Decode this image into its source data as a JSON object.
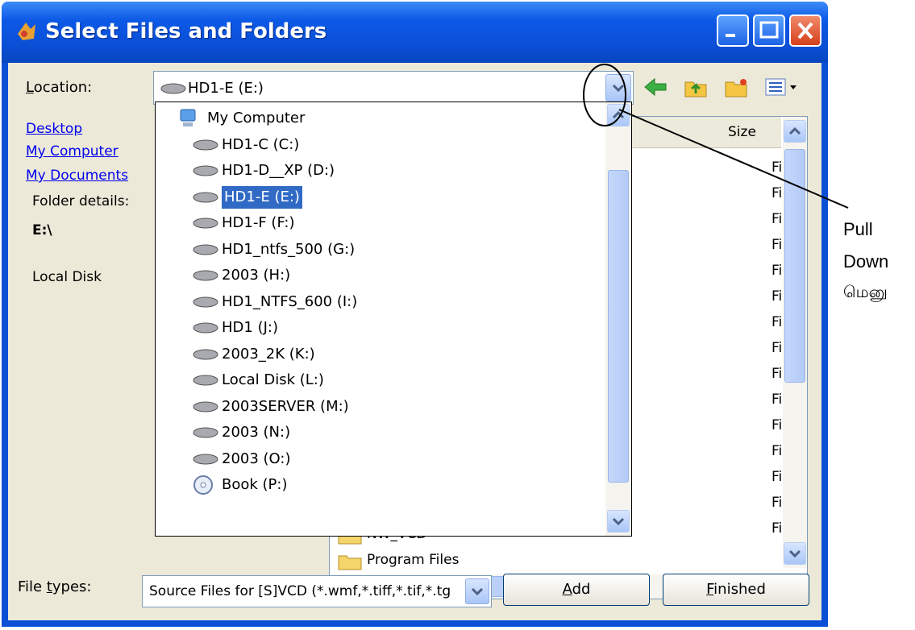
{
  "window": {
    "title": "Select Files and Folders"
  },
  "location": {
    "label": "Location:",
    "value": "HD1-E (E:)"
  },
  "left_pane": {
    "links": [
      "Desktop",
      "My Computer",
      "My Documents"
    ],
    "folder_details_label": "Folder details:",
    "path": "E:\\",
    "disk_type": "Local Disk"
  },
  "file_list": {
    "column_size": "Size",
    "type_cells": [
      "Fil",
      "Fil",
      "Fil",
      "Fil",
      "Fil",
      "Fil",
      "Fil",
      "Fil",
      "Fil",
      "Fil",
      "Fil",
      "Fil",
      "Fil",
      "Fil",
      "Fil"
    ],
    "visible_items": [
      "NW_VCD",
      "Program Files"
    ]
  },
  "dropdown": {
    "items": [
      {
        "label": "My Computer",
        "icon": "computer-icon"
      },
      {
        "label": "HD1-C (C:)",
        "icon": "drive-icon"
      },
      {
        "label": "HD1-D__XP (D:)",
        "icon": "drive-icon"
      },
      {
        "label": "HD1-E (E:)",
        "icon": "drive-icon",
        "selected": true
      },
      {
        "label": "HD1-F (F:)",
        "icon": "drive-icon"
      },
      {
        "label": "HD1_ntfs_500 (G:)",
        "icon": "drive-icon"
      },
      {
        "label": "2003 (H:)",
        "icon": "drive-icon"
      },
      {
        "label": "HD1_NTFS_600 (I:)",
        "icon": "drive-icon"
      },
      {
        "label": "HD1 (J:)",
        "icon": "drive-icon"
      },
      {
        "label": "2003_2K (K:)",
        "icon": "drive-icon"
      },
      {
        "label": "Local Disk (L:)",
        "icon": "drive-icon"
      },
      {
        "label": "2003SERVER (M:)",
        "icon": "drive-icon"
      },
      {
        "label": "2003 (N:)",
        "icon": "drive-icon"
      },
      {
        "label": "2003 (O:)",
        "icon": "drive-icon"
      },
      {
        "label": "Book (P:)",
        "icon": "cd-icon"
      }
    ]
  },
  "file_types": {
    "label": "File types:",
    "value": "Source Files for [S]VCD  (*.wmf,*.tiff,*.tif,*.tg"
  },
  "buttons": {
    "add": "Add",
    "finished": "Finished"
  },
  "annotation": {
    "line1": "Pull",
    "line2": "Down",
    "line3": "மெனு"
  }
}
